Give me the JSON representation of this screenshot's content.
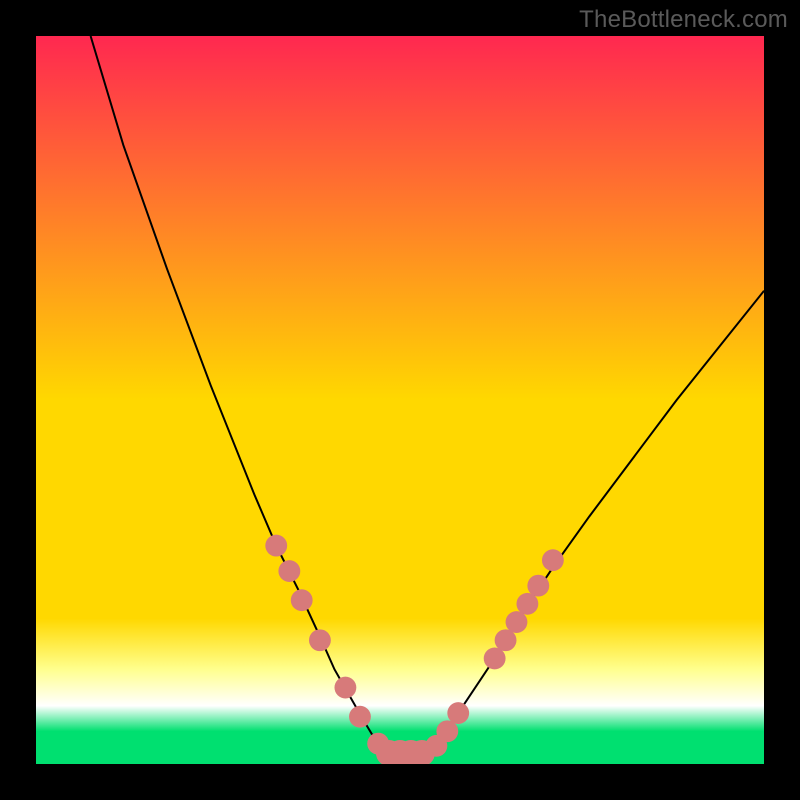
{
  "watermark": "TheBottleneck.com",
  "chart_data": {
    "type": "line",
    "title": "",
    "xlabel": "",
    "ylabel": "",
    "xlim": [
      0,
      100
    ],
    "ylim": [
      0,
      100
    ],
    "background_gradient": {
      "top": "#ff2850",
      "mid": "#ffd800",
      "bottom_highlight": "#ffff8e",
      "bottom_white": "#ffffff",
      "base": "#00e070"
    },
    "series": [
      {
        "name": "left-branch",
        "x": [
          7.5,
          12,
          18,
          24,
          30,
          33,
          36,
          39,
          41,
          43,
          45,
          46.5,
          48
        ],
        "y": [
          100,
          85,
          68,
          52,
          37,
          30,
          24,
          17.5,
          13,
          9.5,
          6,
          3.5,
          1.5
        ]
      },
      {
        "name": "floor",
        "x": [
          48,
          54
        ],
        "y": [
          1.5,
          1.5
        ]
      },
      {
        "name": "right-branch",
        "x": [
          54,
          56,
          58,
          61,
          64,
          67,
          71,
          76,
          82,
          88,
          94,
          100
        ],
        "y": [
          1.5,
          4,
          7,
          11.5,
          16,
          21,
          27,
          34,
          42,
          50,
          57.5,
          65
        ]
      }
    ],
    "markers": [
      {
        "x": 33.0,
        "y": 30.0
      },
      {
        "x": 34.8,
        "y": 26.5
      },
      {
        "x": 36.5,
        "y": 22.5
      },
      {
        "x": 39.0,
        "y": 17.0
      },
      {
        "x": 42.5,
        "y": 10.5
      },
      {
        "x": 44.5,
        "y": 6.5
      },
      {
        "x": 47.0,
        "y": 2.8
      },
      {
        "x": 48.5,
        "y": 1.5
      },
      {
        "x": 50.0,
        "y": 1.5
      },
      {
        "x": 51.5,
        "y": 1.5
      },
      {
        "x": 53.0,
        "y": 1.5
      },
      {
        "x": 55.0,
        "y": 2.5
      },
      {
        "x": 56.5,
        "y": 4.5
      },
      {
        "x": 58.0,
        "y": 7.0
      },
      {
        "x": 63.0,
        "y": 14.5
      },
      {
        "x": 64.5,
        "y": 17.0
      },
      {
        "x": 66.0,
        "y": 19.5
      },
      {
        "x": 67.5,
        "y": 22.0
      },
      {
        "x": 69.0,
        "y": 24.5
      },
      {
        "x": 71.0,
        "y": 28.0
      }
    ],
    "marker_radius": 1.5,
    "floor_marker_radius": 1.8,
    "marker_color": "#d77a7a",
    "line_color": "#000000"
  }
}
